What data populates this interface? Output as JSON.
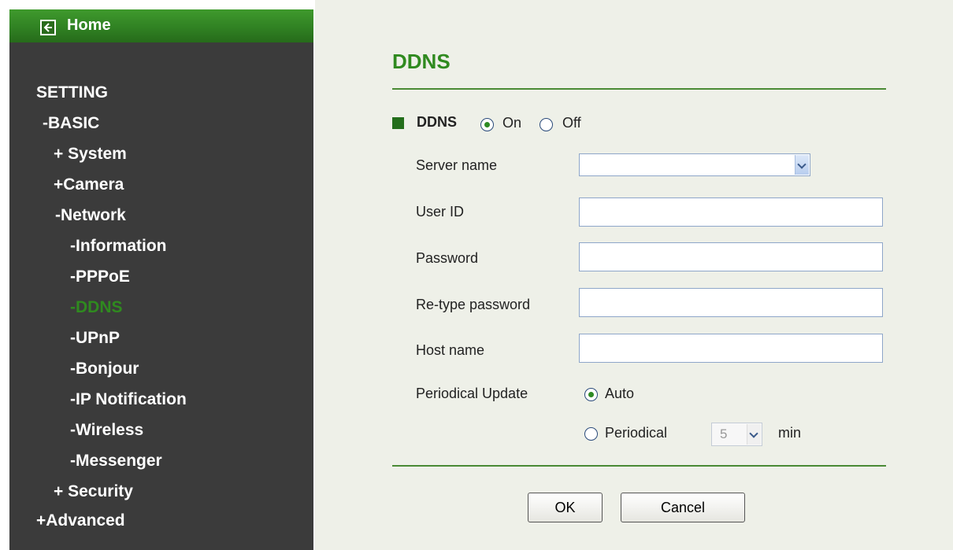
{
  "sidebar": {
    "home_label": "Home",
    "items": [
      {
        "label": "SETTING"
      },
      {
        "label": "-BASIC"
      },
      {
        "label": "+ System"
      },
      {
        "label": "+Camera"
      },
      {
        "label": "-Network"
      },
      {
        "label": "-Information"
      },
      {
        "label": "-PPPoE"
      },
      {
        "label": "-DDNS",
        "active": true
      },
      {
        "label": "-UPnP"
      },
      {
        "label": "-Bonjour"
      },
      {
        "label": "-IP Notification"
      },
      {
        "label": "-Wireless"
      },
      {
        "label": "-Messenger"
      },
      {
        "label": "+ Security"
      },
      {
        "label": "+Advanced"
      }
    ]
  },
  "page": {
    "title": "DDNS",
    "ddns_label": "DDNS",
    "on_label": "On",
    "off_label": "Off",
    "ddns_enabled": "On",
    "server_name_label": "Server name",
    "server_name_value": "",
    "user_id_label": "User ID",
    "user_id_value": "",
    "password_label": "Password",
    "password_value": "",
    "retype_label": "Re-type password",
    "retype_value": "",
    "host_name_label": "Host name",
    "host_name_value": "",
    "periodical_update_label": "Periodical Update",
    "auto_label": "Auto",
    "periodical_label": "Periodical",
    "periodical_selected": "Auto",
    "period_value": "5",
    "min_label": "min",
    "ok_label": "OK",
    "cancel_label": "Cancel"
  },
  "colors": {
    "accent_green": "#2f8a1f",
    "sidebar_bg": "#3b3b3b",
    "content_bg": "#eef0e8"
  }
}
